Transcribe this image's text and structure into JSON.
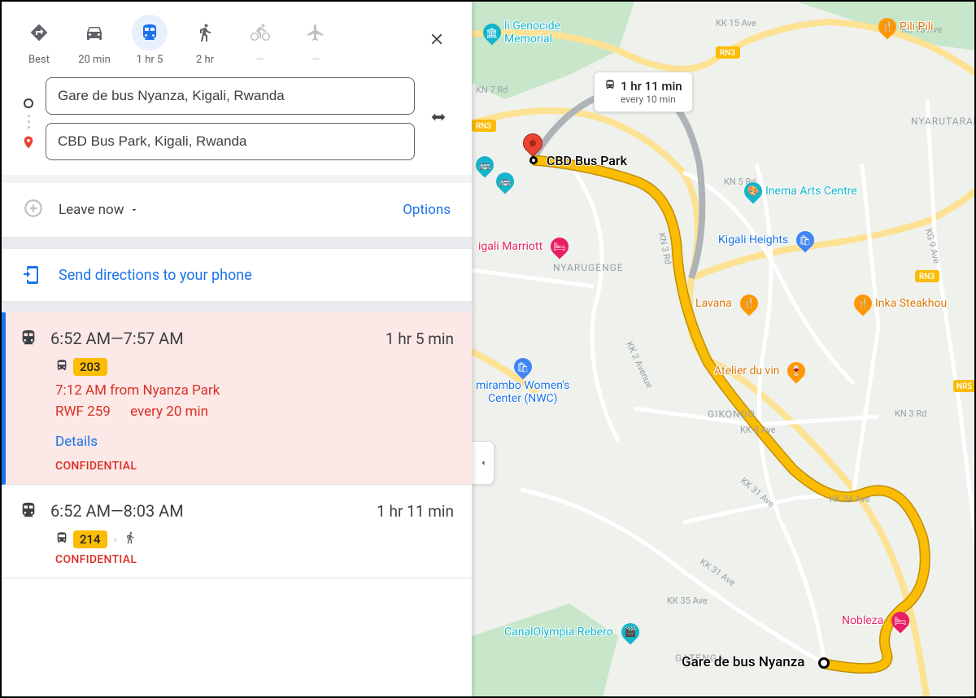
{
  "modes": {
    "best": "Best",
    "car": "20 min",
    "transit": "1 hr 5",
    "walk": "2 hr",
    "bike": "—",
    "plane": "—"
  },
  "origin_value": "Gare de bus Nyanza, Kigali, Rwanda",
  "destination_value": "CBD Bus Park, Kigali, Rwanda",
  "schedule_label": "Leave now",
  "options_label": "Options",
  "send_phone_label": "Send directions to your phone",
  "routes": [
    {
      "times": "6:52 AM—7:57 AM",
      "duration": "1 hr 5 min",
      "line": "203",
      "depart": "7:12 AM from Nyanza Park",
      "fare": "RWF 259",
      "frequency": "every 20 min",
      "details": "Details",
      "confidential": "CONFIDENTIAL",
      "has_walk": false
    },
    {
      "times": "6:52 AM—8:03 AM",
      "duration": "1 hr 11 min",
      "line": "214",
      "confidential": "CONFIDENTIAL",
      "has_walk": true
    }
  ],
  "map": {
    "dest_label": "CBD Bus Park",
    "origin_label": "Gare de bus Nyanza",
    "route_badge": {
      "duration": "1 hr 11 min",
      "frequency": "every 10 min"
    },
    "area_labels": {
      "nyarugenge": "NYARUGENGE",
      "gikondo": "GIKONDO",
      "gatenga": "GATENGA",
      "nyarutaran": "NYARUTARAN"
    },
    "road_labels": {
      "kn3rd": "KN 3 Rd",
      "kk15": "KK 15 Ave",
      "kg15": "KG 15 Ave",
      "kn7": "KN 7 Rd",
      "kn5": "KN 5 Rd",
      "kg9": "KG 9 Ave",
      "kk2": "KK 2 Avenue",
      "kk8": "KK 8 Ave",
      "kk31": "KK 31 Ave",
      "kk31b": "KK 31 Ave",
      "kk35": "KK 35 Ave",
      "kk34": "KK 34 Ave",
      "kn3rd_e": "KN 3 Rd"
    },
    "route_badges": {
      "rn3": "RN3",
      "rn3b": "RN3",
      "nr5": "NR5",
      "rn3c": "RN3"
    },
    "pois": {
      "genocide": "li Genocide\nMemorial",
      "inema": "Inema Arts Centre",
      "kigaliheights": "Kigali Heights",
      "marriott": "igali Marriott",
      "nwc": "mirambo Women's\nCenter (NWC)",
      "lavana": "Lavana",
      "inka": "Inka Steakhou",
      "atelier": "Atelier du vin",
      "canal": "CanalOlympia Rebero",
      "nobleza": "Nobleza",
      "pili": "Pili Pili"
    }
  }
}
